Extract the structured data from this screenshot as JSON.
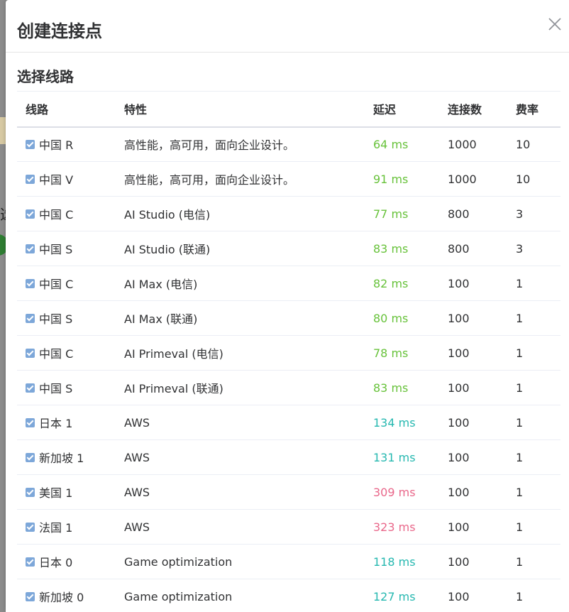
{
  "dialog": {
    "title": "创建连接点",
    "section_title": "选择线路",
    "close_icon": "close-icon"
  },
  "table": {
    "headers": {
      "line": "线路",
      "feature": "特性",
      "latency": "延迟",
      "connections": "连接数",
      "rate": "费率"
    },
    "rows": [
      {
        "checked": true,
        "line": "中国 R",
        "feature": "高性能，高可用，面向企业设计。",
        "latency": "64 ms",
        "latency_color": "#67c23a",
        "connections": "1000",
        "rate": "10"
      },
      {
        "checked": true,
        "line": "中国 V",
        "feature": "高性能，高可用，面向企业设计。",
        "latency": "91 ms",
        "latency_color": "#67c23a",
        "connections": "1000",
        "rate": "10"
      },
      {
        "checked": true,
        "line": "中国 C",
        "feature": "AI Studio (电信)",
        "latency": "77 ms",
        "latency_color": "#67c23a",
        "connections": "800",
        "rate": "3"
      },
      {
        "checked": true,
        "line": "中国 S",
        "feature": "AI Studio (联通)",
        "latency": "83 ms",
        "latency_color": "#67c23a",
        "connections": "800",
        "rate": "3"
      },
      {
        "checked": true,
        "line": "中国 C",
        "feature": "AI Max (电信)",
        "latency": "82 ms",
        "latency_color": "#67c23a",
        "connections": "100",
        "rate": "1"
      },
      {
        "checked": true,
        "line": "中国 S",
        "feature": "AI Max (联通)",
        "latency": "80 ms",
        "latency_color": "#67c23a",
        "connections": "100",
        "rate": "1"
      },
      {
        "checked": true,
        "line": "中国 C",
        "feature": "AI Primeval (电信)",
        "latency": "78 ms",
        "latency_color": "#67c23a",
        "connections": "100",
        "rate": "1"
      },
      {
        "checked": true,
        "line": "中国 S",
        "feature": "AI Primeval (联通)",
        "latency": "83 ms",
        "latency_color": "#67c23a",
        "connections": "100",
        "rate": "1"
      },
      {
        "checked": true,
        "line": "日本 1",
        "feature": "AWS",
        "latency": "134 ms",
        "latency_color": "#26b8b0",
        "connections": "100",
        "rate": "1"
      },
      {
        "checked": true,
        "line": "新加坡 1",
        "feature": "AWS",
        "latency": "131 ms",
        "latency_color": "#26b8b0",
        "connections": "100",
        "rate": "1"
      },
      {
        "checked": true,
        "line": "美国 1",
        "feature": "AWS",
        "latency": "309 ms",
        "latency_color": "#e9678a",
        "connections": "100",
        "rate": "1"
      },
      {
        "checked": true,
        "line": "法国 1",
        "feature": "AWS",
        "latency": "323 ms",
        "latency_color": "#e9678a",
        "connections": "100",
        "rate": "1"
      },
      {
        "checked": true,
        "line": "日本 0",
        "feature": "Game optimization",
        "latency": "118 ms",
        "latency_color": "#26b8b0",
        "connections": "100",
        "rate": "1"
      },
      {
        "checked": true,
        "line": "新加坡 0",
        "feature": "Game optimization",
        "latency": "127 ms",
        "latency_color": "#26b8b0",
        "connections": "100",
        "rate": "1"
      }
    ]
  },
  "background": {
    "partial_char": "选"
  }
}
